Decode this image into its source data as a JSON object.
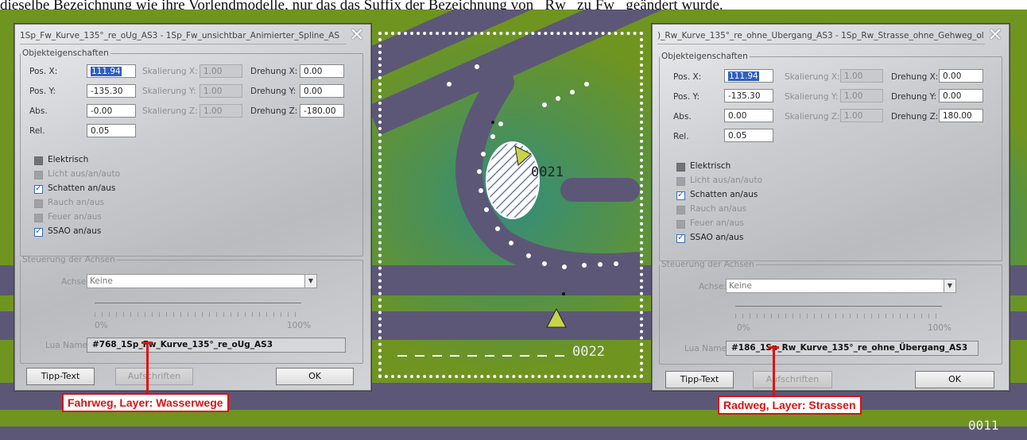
{
  "caption": "dieselbe Bezeichnung wie ihre Vorlendmodelle, nur das das Suffix der Bezeichnung von _Rw_ zu Fw_ geändert wurde.",
  "left_dialog": {
    "title": "1Sp_Fw_Kurve_135°_re_oUg_AS3 - 1Sp_Fw_unsichtbar_Animierter_Spline_AS",
    "close": "✕",
    "group_title": "Objekteigenschaften",
    "pos_x_label": "Pos. X:",
    "pos_x": "111.94",
    "pos_y_label": "Pos. Y:",
    "pos_y": "-135.30",
    "abs_label": "Abs.",
    "abs": "-0.00",
    "rel_label": "Rel.",
    "rel": "0.05",
    "scale_x_label": "Skalierung X:",
    "scale_x": "1.00",
    "scale_y_label": "Skalierung Y:",
    "scale_y": "1.00",
    "scale_z_label": "Skalierung Z:",
    "scale_z": "1.00",
    "rot_x_label": "Drehung X:",
    "rot_x": "0.00",
    "rot_y_label": "Drehung Y:",
    "rot_y": "0.00",
    "rot_z_label": "Drehung Z:",
    "rot_z": "-180.00",
    "cb_elektrisch": "Elektrisch",
    "cb_licht": "Licht aus/an/auto",
    "cb_schatten": "Schatten an/aus",
    "cb_rauch": "Rauch an/aus",
    "cb_feuer": "Feuer an/aus",
    "cb_ssao": "SSAO an/aus",
    "axes_title": "Steuerung der Achsen",
    "achse_label": "Achse:",
    "achse_value": "Keine",
    "pct_min": "0%",
    "pct_max": "100%",
    "lua_label": "Lua Name:",
    "lua_value": "#768_1Sp_Fw_Kurve_135°_re_oUg_AS3",
    "btn_tipp": "Tipp-Text",
    "btn_auf": "Aufschriften",
    "btn_ok": "OK"
  },
  "right_dialog": {
    "title": ")_Rw_Kurve_135°_re_ohne_Übergang_AS3 - 1Sp_Rw_Strasse_ohne_Gehweg_ol",
    "close": "✕",
    "group_title": "Objekteigenschaften",
    "pos_x_label": "Pos. X:",
    "pos_x": "111.94",
    "pos_y_label": "Pos. Y:",
    "pos_y": "-135.30",
    "abs_label": "Abs.",
    "abs": "0.00",
    "rel_label": "Rel.",
    "rel": "0.05",
    "scale_x_label": "Skalierung X:",
    "scale_x": "1.00",
    "scale_y_label": "Skalierung Y:",
    "scale_y": "1.00",
    "scale_z_label": "Skalierung Z:",
    "scale_z": "1.00",
    "rot_x_label": "Drehung X:",
    "rot_x": "0.00",
    "rot_y_label": "Drehung Y:",
    "rot_y": "0.00",
    "rot_z_label": "Drehung Z:",
    "rot_z": "180.00",
    "cb_elektrisch": "Elektrisch",
    "cb_licht": "Licht aus/an/auto",
    "cb_schatten": "Schatten an/aus",
    "cb_rauch": "Rauch an/aus",
    "cb_feuer": "Feuer an/aus",
    "cb_ssao": "SSAO an/aus",
    "axes_title": "Steuerung der Achsen",
    "achse_label": "Achse:",
    "achse_value": "Keine",
    "pct_min": "0%",
    "pct_max": "100%",
    "lua_label": "Lua Name:",
    "lua_value": "#186_1Sp_Rw_Kurve_135°_re_ohne_Übergang_AS3",
    "btn_tipp": "Tipp-Text",
    "btn_auf": "Aufschriften",
    "btn_ok": "OK"
  },
  "annotations": {
    "left": "Fahrweg, Layer: Wasserwege",
    "right": "Radweg, Layer: Strassen"
  },
  "map": {
    "label_1": "0021",
    "label_2": "0022",
    "label_3": "0011"
  },
  "colors": {
    "accent_red": "#d11111",
    "road": "#5c5776",
    "ground": "#6f9420"
  }
}
